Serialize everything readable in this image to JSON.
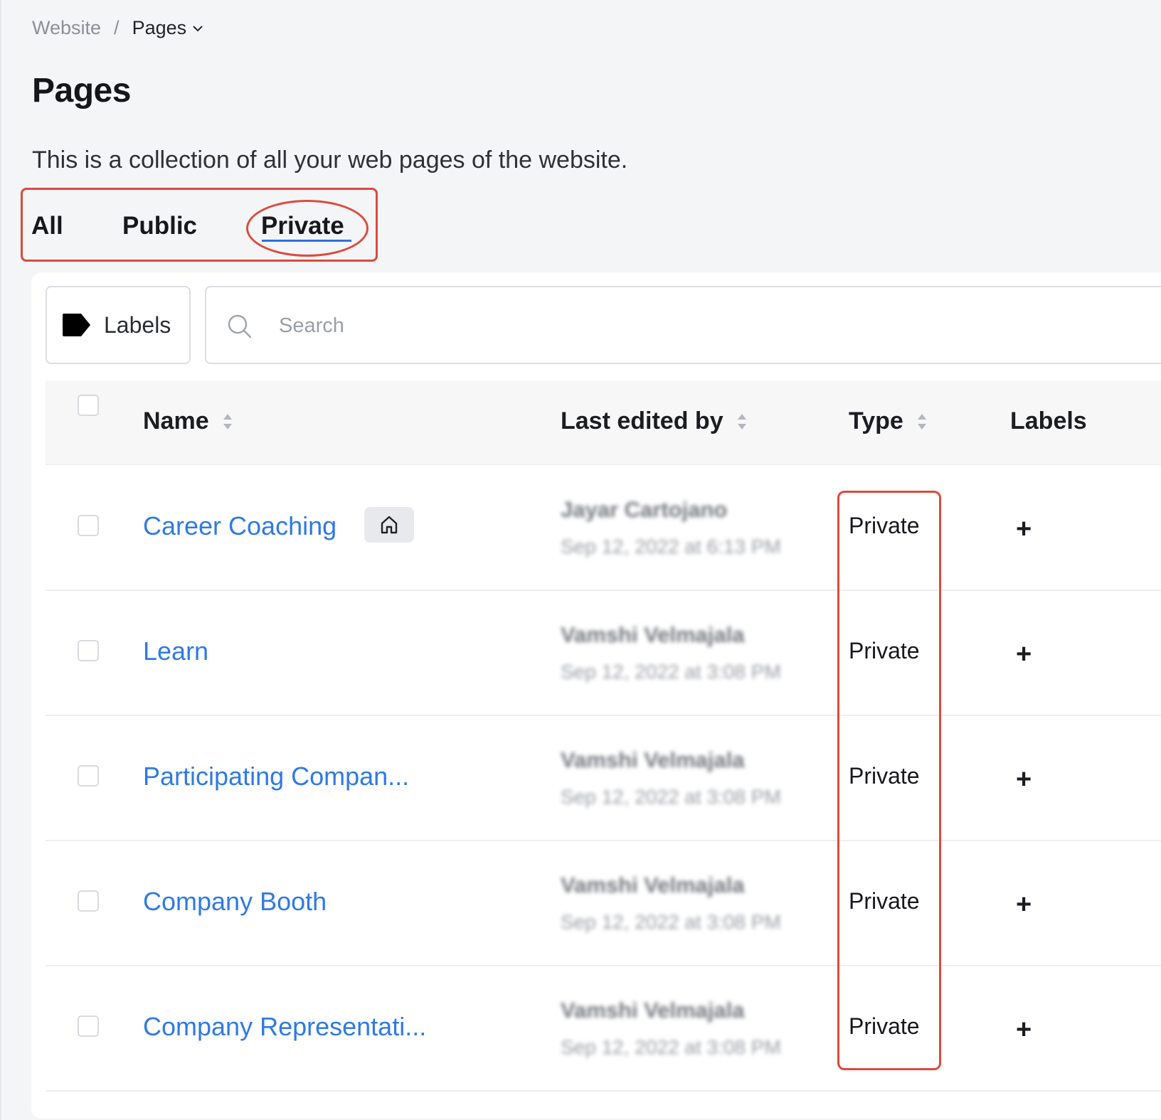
{
  "breadcrumb": {
    "root": "Website",
    "separator": "/",
    "current": "Pages"
  },
  "page": {
    "title": "Pages",
    "description": "This is a collection of all your web pages of the website."
  },
  "tabs": [
    {
      "label": "All",
      "active": false
    },
    {
      "label": "Public",
      "active": false
    },
    {
      "label": "Private",
      "active": true
    }
  ],
  "toolbar": {
    "labels_button": "Labels",
    "search_placeholder": "Search"
  },
  "table": {
    "columns": [
      "Name",
      "Last edited by",
      "Type",
      "Labels"
    ],
    "rows": [
      {
        "name": "Career Coaching",
        "home": true,
        "editor": "Jayar Cartojano",
        "edited": "Sep 12, 2022 at 6:13 PM",
        "type": "Private",
        "add": "+"
      },
      {
        "name": "Learn",
        "home": false,
        "editor": "Vamshi Velmajala",
        "edited": "Sep 12, 2022 at 3:08 PM",
        "type": "Private",
        "add": "+"
      },
      {
        "name": "Participating Compan...",
        "home": false,
        "editor": "Vamshi Velmajala",
        "edited": "Sep 12, 2022 at 3:08 PM",
        "type": "Private",
        "add": "+"
      },
      {
        "name": "Company Booth",
        "home": false,
        "editor": "Vamshi Velmajala",
        "edited": "Sep 12, 2022 at 3:08 PM",
        "type": "Private",
        "add": "+"
      },
      {
        "name": "Company Representati...",
        "home": false,
        "editor": "Vamshi Velmajala",
        "edited": "Sep 12, 2022 at 3:08 PM",
        "type": "Private",
        "add": "+"
      }
    ]
  },
  "colors": {
    "accent": "#2f6fe0",
    "link": "#2f7ae5",
    "annotation": "#dc4a3d"
  },
  "icons": [
    "chevron-down-icon",
    "label-tag-icon",
    "search-icon",
    "sort-icon",
    "home-icon",
    "plus-icon"
  ]
}
